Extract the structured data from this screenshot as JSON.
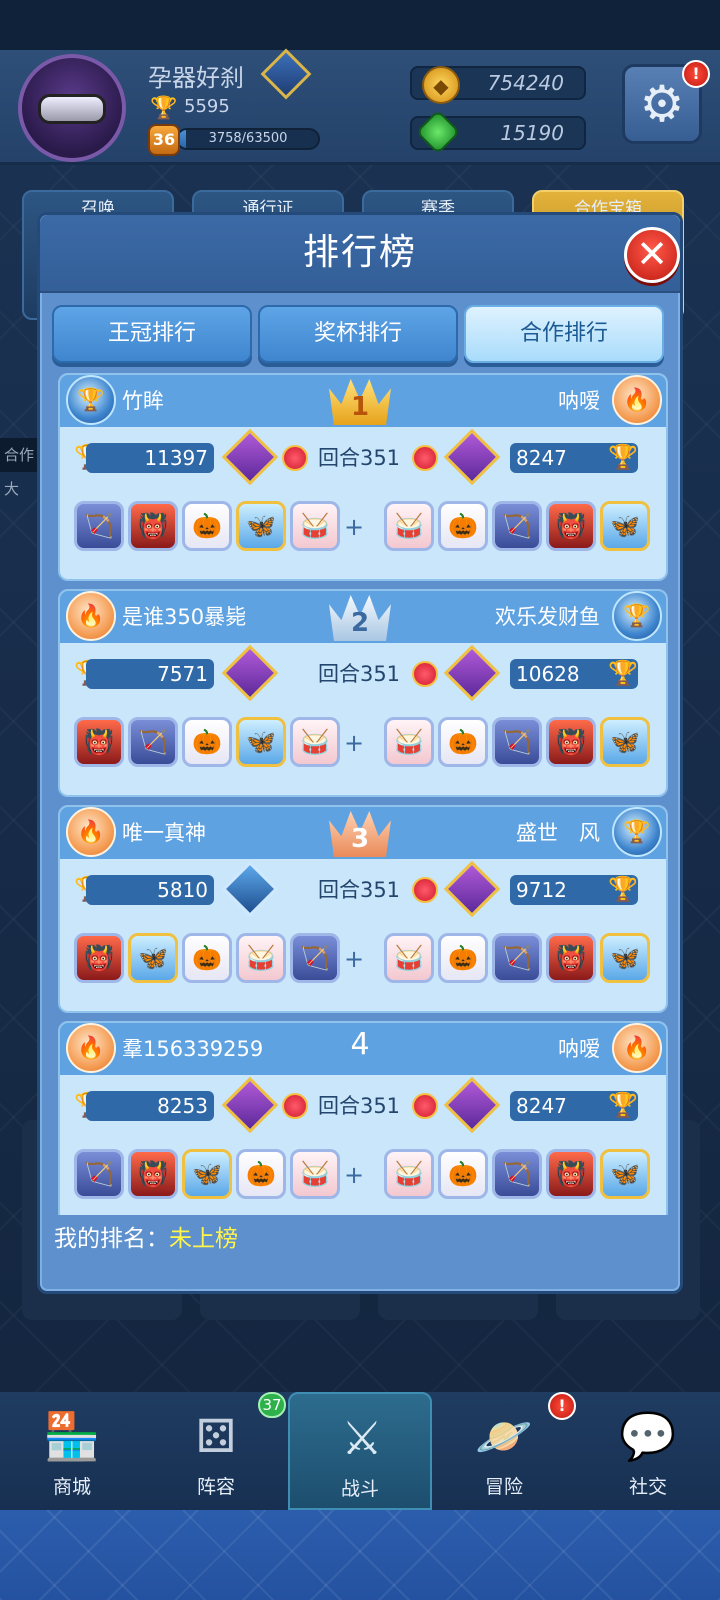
{
  "header": {
    "player_name": "孕器好刹",
    "trophies": "5595",
    "level": "36",
    "xp_text": "3758/63500",
    "xp_progress": 0.06,
    "gold": "754240",
    "gems": "15190"
  },
  "background_tabs": [
    "召唤",
    "通行证",
    "赛季",
    "合作宝箱"
  ],
  "background_banner": "合作大",
  "modal": {
    "title": "排行榜",
    "close_symbol": "✕",
    "tabs": [
      {
        "label": "王冠排行",
        "active": false
      },
      {
        "label": "奖杯排行",
        "active": false
      },
      {
        "label": "合作排行",
        "active": true
      }
    ],
    "rounds_label": "回合351",
    "plus_symbol": "+",
    "entries": [
      {
        "rank": "1",
        "crown": "gold",
        "left": {
          "name": "竹眸",
          "avatar": "blue-trophy-avatar",
          "trophies": "11397"
        },
        "right": {
          "name": "呐嗳",
          "avatar": "orange-flame-avatar",
          "trophies": "8247"
        },
        "rounds": "回合351",
        "left_deck": [
          "archer",
          "demon",
          "pumpkin",
          "butterfly",
          "drum"
        ],
        "right_deck": [
          "drum",
          "pumpkin",
          "archer",
          "demon",
          "butterfly"
        ]
      },
      {
        "rank": "2",
        "crown": "silver",
        "left": {
          "name": "是谁350暴毙",
          "avatar": "orange-flame-avatar",
          "trophies": "7571"
        },
        "right": {
          "name": "欢乐发财鱼",
          "avatar": "blue-trophy-avatar",
          "trophies": "10628"
        },
        "rounds": "回合351",
        "left_deck": [
          "demon",
          "archer",
          "pumpkin",
          "butterfly",
          "drum"
        ],
        "right_deck": [
          "drum",
          "pumpkin",
          "archer",
          "demon",
          "butterfly"
        ]
      },
      {
        "rank": "3",
        "crown": "bronze",
        "left": {
          "name": "唯一真神",
          "avatar": "orange-flame-avatar",
          "trophies": "5810"
        },
        "right": {
          "name": "盛世　风",
          "avatar": "blue-trophy-avatar",
          "trophies": "9712"
        },
        "rounds": "回合351",
        "left_deck": [
          "demon",
          "butterfly",
          "pumpkin",
          "drum",
          "archer"
        ],
        "right_deck": [
          "drum",
          "pumpkin",
          "archer",
          "demon",
          "butterfly"
        ]
      },
      {
        "rank": "4",
        "crown": "none",
        "left": {
          "name": "羣156339259",
          "avatar": "orange-flame-avatar",
          "trophies": "8253"
        },
        "right": {
          "name": "呐嗳",
          "avatar": "orange-flame-avatar",
          "trophies": "8247"
        },
        "rounds": "回合351",
        "left_deck": [
          "archer",
          "demon",
          "butterfly",
          "pumpkin",
          "drum"
        ],
        "right_deck": [
          "drum",
          "pumpkin",
          "archer",
          "demon",
          "butterfly"
        ]
      }
    ],
    "my_rank_label": "我的排名：",
    "my_rank_value": "未上榜"
  },
  "nav": {
    "items": [
      {
        "label": "商城",
        "icon": "shop-icon"
      },
      {
        "label": "阵容",
        "icon": "dice-icon"
      },
      {
        "label": "战斗",
        "icon": "crossed-swords-icon",
        "active": true
      },
      {
        "label": "冒险",
        "icon": "planet-icon"
      },
      {
        "label": "社交",
        "icon": "chat-bubbles-icon"
      }
    ],
    "lineup_badge": "37",
    "alert_symbol": "!"
  },
  "colors": {
    "modal_bg": "#5d90cd",
    "active_tab": "#a9dcfb",
    "entry_bg": "#c9e6fa",
    "highlight_yellow": "#fff44a"
  }
}
